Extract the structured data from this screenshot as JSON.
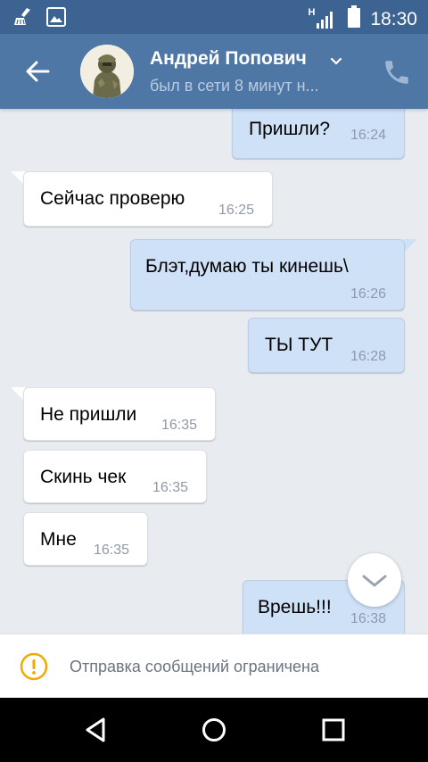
{
  "status_bar": {
    "time": "18:30",
    "network_label": "H",
    "icons": [
      "broom-icon",
      "image-icon",
      "signal-icon",
      "battery-icon"
    ]
  },
  "header": {
    "contact_name": "Андрей Попович",
    "contact_status": "был в сети 8 минут н...",
    "icons": [
      "back-arrow-icon",
      "avatar",
      "chevron-down-icon",
      "phone-icon"
    ]
  },
  "messages": [
    {
      "direction": "out",
      "text": "Пришли?",
      "time": "16:24"
    },
    {
      "direction": "in",
      "text": "Сейчас проверю",
      "time": "16:25"
    },
    {
      "direction": "out",
      "text": "Блэт,думаю ты кинешь\\",
      "time": "16:26"
    },
    {
      "direction": "out",
      "text": "ТЫ ТУТ",
      "time": "16:28"
    },
    {
      "direction": "in",
      "text": "Не пришли",
      "time": "16:35"
    },
    {
      "direction": "in",
      "text": "Скинь чек",
      "time": "16:35"
    },
    {
      "direction": "in",
      "text": "Мне",
      "time": "16:35"
    },
    {
      "direction": "out",
      "text": "Врешь!!!",
      "time": "16:38"
    }
  ],
  "notice": {
    "text": "Отправка сообщений ограничена",
    "icon": "warning-circle-icon"
  },
  "navbar": {
    "icons": [
      "nav-back-icon",
      "nav-home-icon",
      "nav-recents-icon"
    ]
  },
  "colors": {
    "status_bar": "#3d6393",
    "header": "#4e77a6",
    "chat_bg": "#e8ecf1",
    "outgoing_bubble": "#cfe1f7",
    "incoming_bubble": "#ffffff",
    "warning": "#f2a900"
  }
}
